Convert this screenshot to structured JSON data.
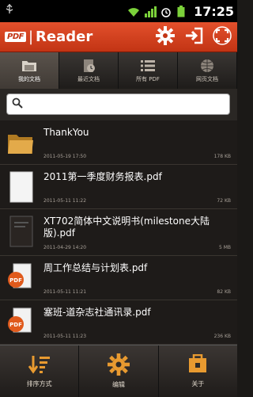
{
  "status_bar": {
    "time": "17:25",
    "icons": [
      "usb-icon",
      "wifi-icon",
      "signal-icon",
      "alarm-icon",
      "battery-icon"
    ]
  },
  "header": {
    "brand": "PDF",
    "title": "Reader",
    "actions": [
      "settings-icon",
      "login-icon",
      "fullscreen-icon"
    ]
  },
  "tabs": [
    {
      "label": "我的文档",
      "icon": "folder-icon",
      "active": true
    },
    {
      "label": "最近文档",
      "icon": "recent-icon",
      "active": false
    },
    {
      "label": "所有 PDF",
      "icon": "list-icon",
      "active": false
    },
    {
      "label": "网页文档",
      "icon": "globe-icon",
      "active": false
    }
  ],
  "search": {
    "placeholder": ""
  },
  "files": [
    {
      "name": "ThankYou",
      "date": "2011-05-19 17:50",
      "size": "178 KB",
      "type": "folder"
    },
    {
      "name": "2011第一季度财务报表.pdf",
      "date": "2011-05-11 11:22",
      "size": "72 KB",
      "type": "blank"
    },
    {
      "name": "XT702简体中文说明书(milestone大陆版).pdf",
      "date": "2011-04-29 14:20",
      "size": "5 MB",
      "type": "dark"
    },
    {
      "name": "周工作总结与计划表.pdf",
      "date": "2011-05-11 11:21",
      "size": "82 KB",
      "type": "pdf"
    },
    {
      "name": "塞班-道杂志社通讯录.pdf",
      "date": "2011-05-11 11:23",
      "size": "236 KB",
      "type": "pdf"
    }
  ],
  "bottom": [
    {
      "label": "排序方式",
      "icon": "sort-icon"
    },
    {
      "label": "编辑",
      "icon": "gear-icon"
    },
    {
      "label": "关于",
      "icon": "about-icon"
    }
  ],
  "colors": {
    "accent": "#d8441f",
    "background": "#1b1917"
  }
}
